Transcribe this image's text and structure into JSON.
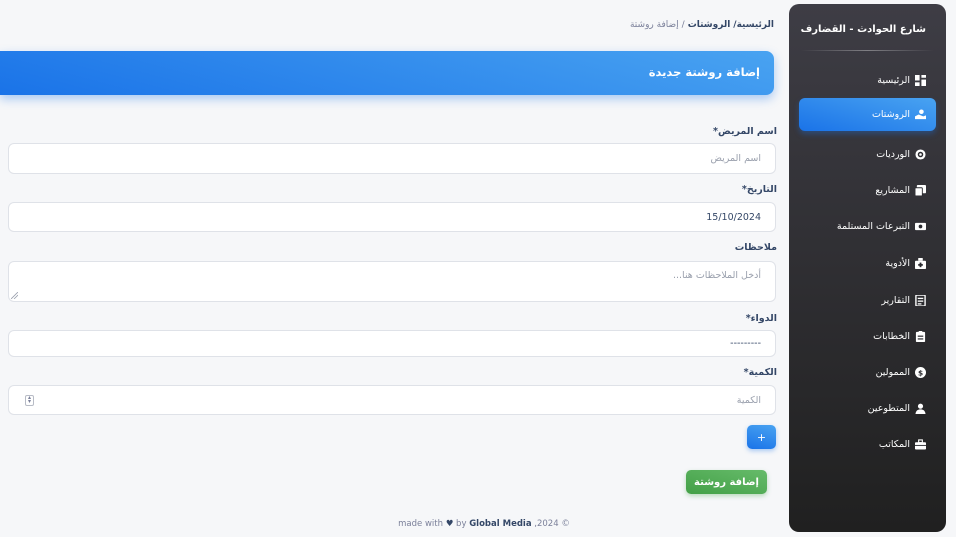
{
  "sidebar": {
    "brand": "شارع الحوادث - القضارف",
    "items": [
      {
        "label": "الرئيسية",
        "icon": "dashboard-icon",
        "active": false
      },
      {
        "label": "الروشتات",
        "icon": "prescription-icon",
        "active": true
      },
      {
        "label": "الورديات",
        "icon": "shifts-icon",
        "active": false
      },
      {
        "label": "المشاريع",
        "icon": "projects-icon",
        "active": false
      },
      {
        "label": "التبرعات المستلمة",
        "icon": "donations-icon",
        "active": false
      },
      {
        "label": "الأدوية",
        "icon": "medicine-icon",
        "active": false
      },
      {
        "label": "التقارير",
        "icon": "reports-icon",
        "active": false
      },
      {
        "label": "الخطابات",
        "icon": "letters-icon",
        "active": false
      },
      {
        "label": "الممولين",
        "icon": "funders-icon",
        "active": false
      },
      {
        "label": "المتطوعين",
        "icon": "volunteers-icon",
        "active": false
      },
      {
        "label": "المكاتب",
        "icon": "offices-icon",
        "active": false
      }
    ]
  },
  "breadcrumb": {
    "home": "الرئيسية/",
    "section": "الروشتات",
    "separator": "/",
    "current": "إضافة روشتة"
  },
  "page": {
    "title": "إضافة روشتة جديدة"
  },
  "form": {
    "patient_label": "اسم المريض*",
    "patient_placeholder": "اسم المريض",
    "date_label": "التاريخ*",
    "date_value": "15/10/2024",
    "notes_label": "ملاحظات",
    "notes_placeholder": "أدخل الملاحظات هنا...",
    "medicine_label": "الدواء*",
    "medicine_value": "---------",
    "quantity_label": "الكمية*",
    "quantity_placeholder": "الكمية",
    "add_row_label": "+",
    "submit_label": "إضافة روشتة"
  },
  "footer": {
    "made_with": "made with",
    "by": "by",
    "company": "Global Media",
    "year": ",2024 ©"
  },
  "colors": {
    "primary": "#1a73e8",
    "success": "#43a047",
    "sidebar_dark": "#202020"
  }
}
